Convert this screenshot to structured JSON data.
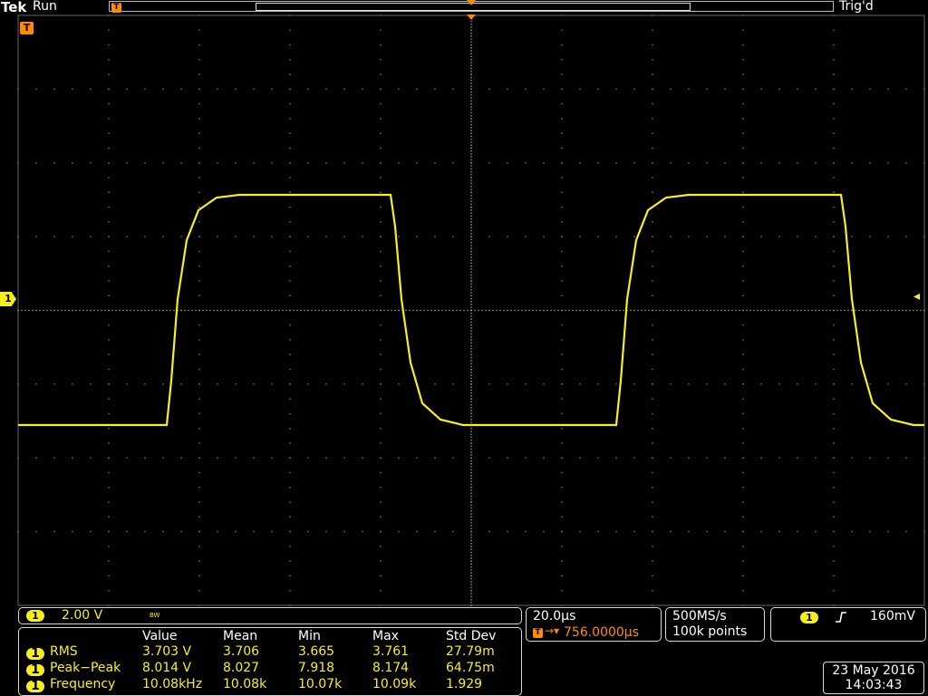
{
  "header": {
    "brand": "Tek",
    "run_state": "Run",
    "trigger_state": "Trig'd"
  },
  "markers": {
    "trigger_icon": "T",
    "channel_marker": "1",
    "trigger_level_icon": "◂"
  },
  "channel": {
    "number": "1",
    "scale": "2.00 V",
    "bw_limit": "BW"
  },
  "timebase": {
    "scale": "20.0µs",
    "position": "756.0000µs",
    "position_prefix": "T",
    "sample_rate": "500MS/s",
    "record_length": "100k points"
  },
  "trigger": {
    "source": "1",
    "slope_icon": "rising-edge-icon",
    "level": "160mV"
  },
  "measurements": {
    "headers": [
      "Value",
      "Mean",
      "Min",
      "Max",
      "Std Dev"
    ],
    "rows": [
      {
        "ch": "1",
        "name": "RMS",
        "value": "3.703 V",
        "mean": "3.706",
        "min": "3.665",
        "max": "3.761",
        "std": "27.79m"
      },
      {
        "ch": "1",
        "name": "Peak−Peak",
        "value": "8.014 V",
        "mean": "8.027",
        "min": "7.918",
        "max": "8.174",
        "std": "64.75m"
      },
      {
        "ch": "1",
        "name": "Frequency",
        "value": "10.08kHz",
        "mean": "10.08k",
        "min": "10.07k",
        "max": "10.09k",
        "std": "1.929"
      }
    ]
  },
  "datetime": {
    "date": "23 May 2016",
    "time": "14:03:43"
  },
  "colors": {
    "trace": "#f7ef1a",
    "marker": "#ff8c00",
    "background": "#000000"
  }
}
